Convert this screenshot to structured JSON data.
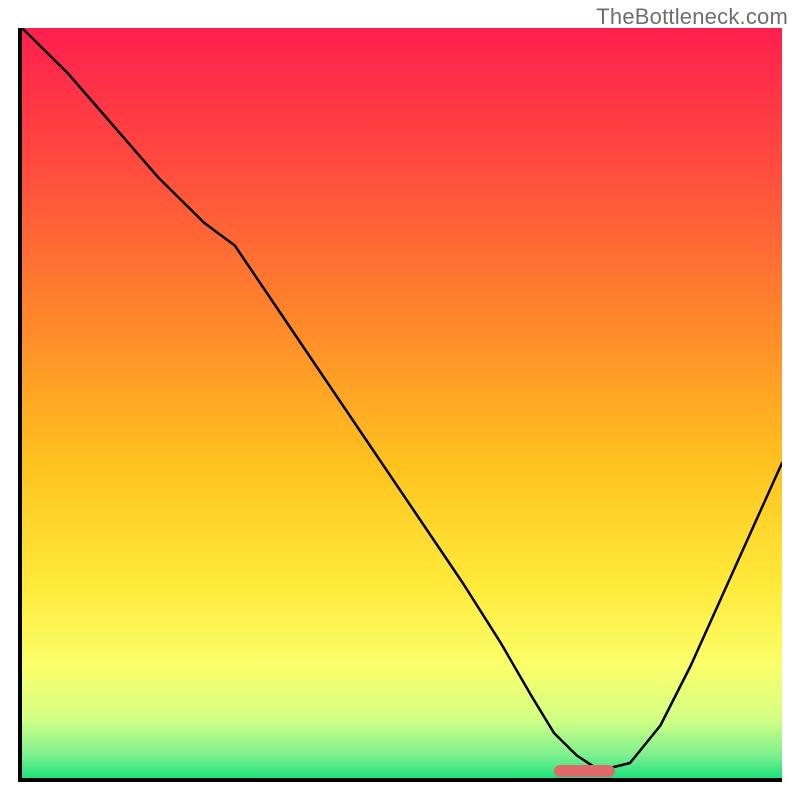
{
  "watermark": "TheBottleneck.com",
  "chart_data": {
    "type": "line",
    "title": "",
    "xlabel": "",
    "ylabel": "",
    "xlim": [
      0,
      100
    ],
    "ylim": [
      0,
      100
    ],
    "grid": false,
    "legend": false,
    "background_gradient": {
      "stops": [
        {
          "offset": 0.0,
          "color": "#ff1f4e"
        },
        {
          "offset": 0.18,
          "color": "#ff4a3f"
        },
        {
          "offset": 0.4,
          "color": "#ff8a2a"
        },
        {
          "offset": 0.58,
          "color": "#ffc21e"
        },
        {
          "offset": 0.74,
          "color": "#ffe93a"
        },
        {
          "offset": 0.85,
          "color": "#fbff6a"
        },
        {
          "offset": 0.92,
          "color": "#d4ff84"
        },
        {
          "offset": 0.97,
          "color": "#7df08f"
        },
        {
          "offset": 1.0,
          "color": "#1de27a"
        }
      ]
    },
    "series": [
      {
        "name": "bottleneck-curve",
        "stroke": "#000000",
        "stroke_width": 2.5,
        "x": [
          0,
          6,
          12,
          18,
          24,
          28,
          34,
          40,
          46,
          52,
          58,
          63,
          67,
          70,
          73,
          76,
          80,
          84,
          88,
          92,
          96,
          100
        ],
        "y": [
          100,
          94,
          87,
          80,
          74,
          71,
          62,
          53,
          44,
          35,
          26,
          18,
          11,
          6,
          3,
          1,
          2,
          7,
          15,
          24,
          33,
          42
        ]
      }
    ],
    "marker": {
      "name": "optimal-range",
      "shape": "rounded-bar",
      "fill": "#e06a6a",
      "x_start": 70,
      "x_end": 78,
      "y": 0,
      "height_pct": 1.6
    }
  }
}
